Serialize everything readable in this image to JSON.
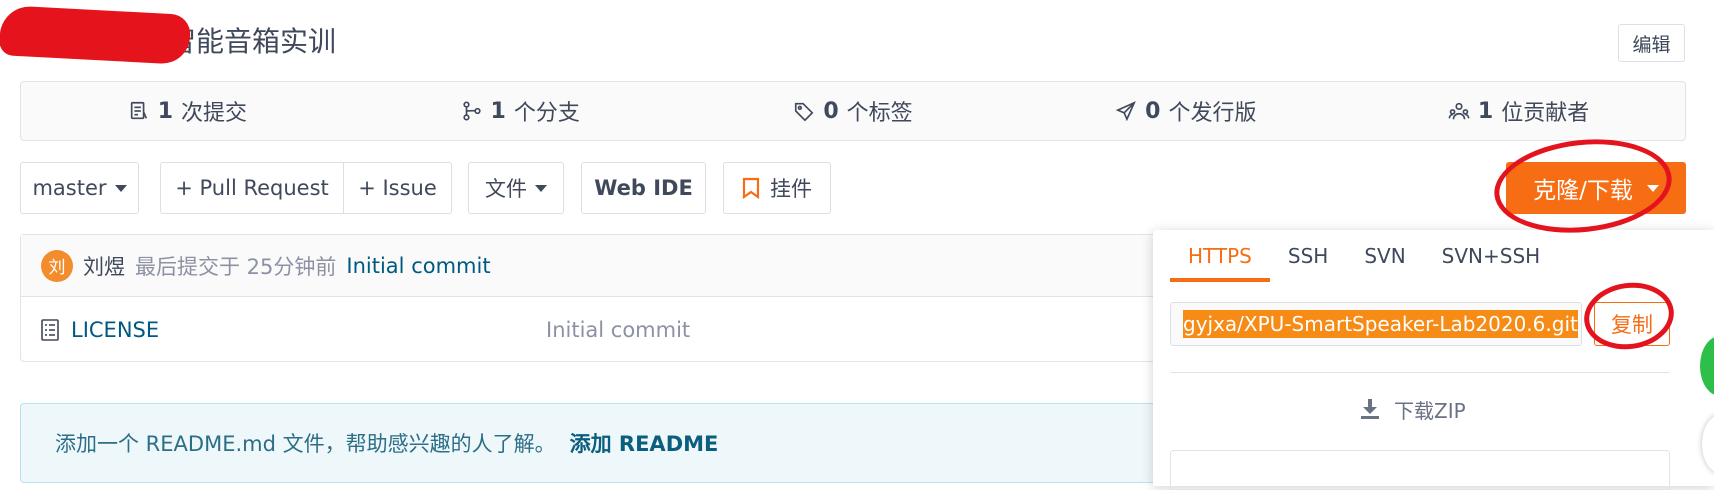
{
  "repo": {
    "title_visible": "智能音箱实训",
    "edit_label": "编辑"
  },
  "stats": [
    {
      "icon": "commit-icon",
      "count": "1",
      "label": "次提交"
    },
    {
      "icon": "branch-icon",
      "count": "1",
      "label": "个分支"
    },
    {
      "icon": "tag-icon",
      "count": "0",
      "label": "个标签"
    },
    {
      "icon": "release-icon",
      "count": "0",
      "label": "个发行版"
    },
    {
      "icon": "contributors-icon",
      "count": "1",
      "label": "位贡献者"
    }
  ],
  "toolbar": {
    "branch": "master",
    "pull_request": "+ Pull Request",
    "issue": "+ Issue",
    "files": "文件",
    "web_ide": "Web IDE",
    "widget": "挂件",
    "clone": "克隆/下载"
  },
  "commit": {
    "avatar_char": "刘",
    "author": "刘煜",
    "time": "最后提交于 25分钟前",
    "message": "Initial commit"
  },
  "files": [
    {
      "name": "LICENSE",
      "commit": "Initial commit"
    }
  ],
  "readme": {
    "text": "添加一个 README.md 文件，帮助感兴趣的人了解。",
    "link": "添加 README"
  },
  "clone_panel": {
    "tabs": [
      "HTTPS",
      "SSH",
      "SVN",
      "SVN+SSH"
    ],
    "active_tab": "HTTPS",
    "url_visible": "gyjxa/XPU-SmartSpeaker-Lab2020.6.git",
    "copy_label": "复制",
    "zip_label": "下载ZIP"
  },
  "colors": {
    "accent": "#f66d14",
    "link": "#005980",
    "annotation": "#e3141e"
  }
}
